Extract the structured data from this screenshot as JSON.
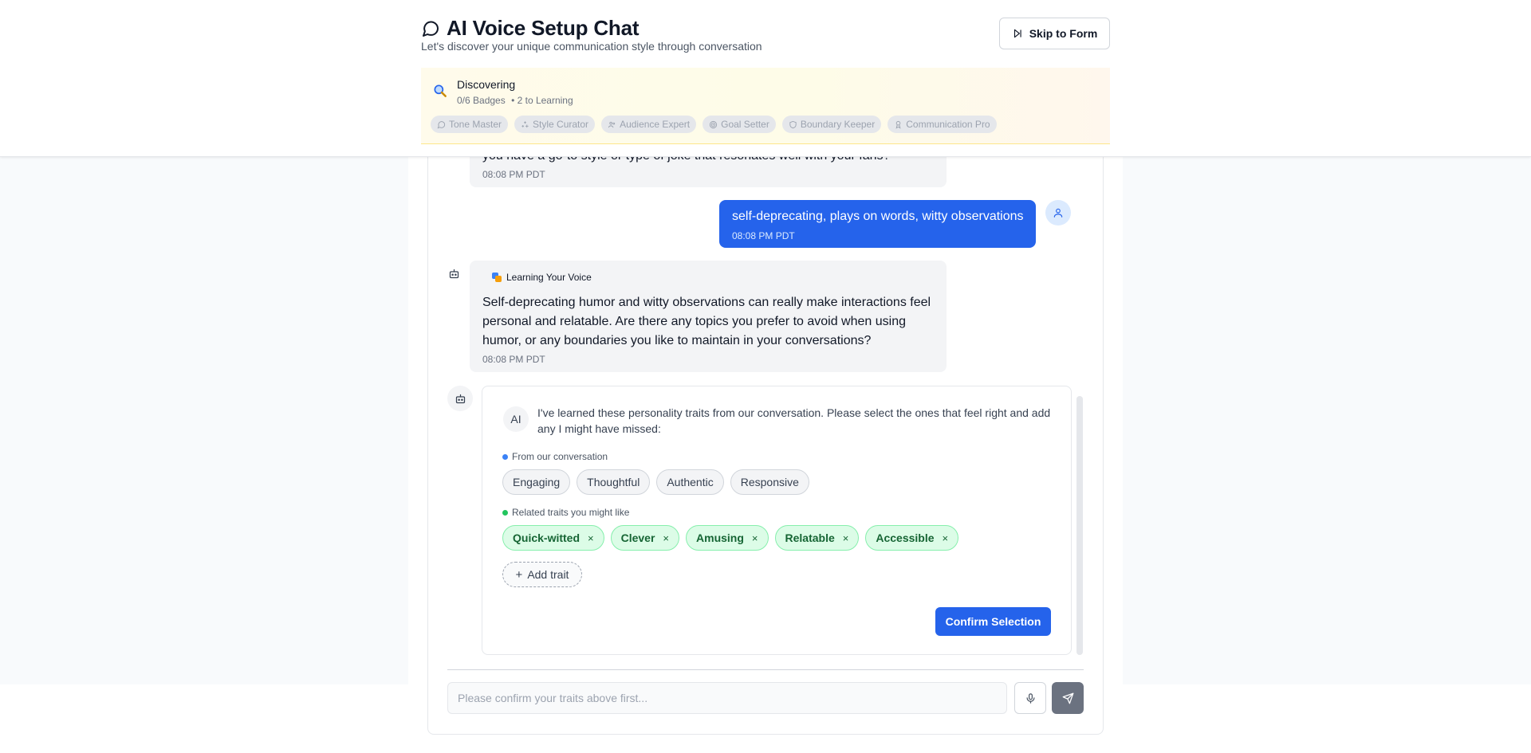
{
  "header": {
    "title": "AI Voice Setup Chat",
    "subtitle": "Let's discover your unique communication style through conversation",
    "skip_label": "Skip to Form"
  },
  "progress": {
    "stage": "Discovering",
    "badges_count": "0/6 Badges",
    "next_stage": "• 2 to Learning",
    "badges": [
      {
        "label": "Tone Master",
        "icon": "message-icon"
      },
      {
        "label": "Style Curator",
        "icon": "sparkles-icon"
      },
      {
        "label": "Audience Expert",
        "icon": "users-icon"
      },
      {
        "label": "Goal Setter",
        "icon": "target-icon"
      },
      {
        "label": "Boundary Keeper",
        "icon": "shield-icon"
      },
      {
        "label": "Communication Pro",
        "icon": "award-icon"
      }
    ]
  },
  "messages": [
    {
      "role": "ai",
      "text": "you have a go-to style or type of joke that resonates well with your fans?",
      "time": "08:08 PM PDT"
    },
    {
      "role": "user",
      "text": "self-deprecating, plays on words, witty observations",
      "time": "08:08 PM PDT"
    },
    {
      "role": "ai",
      "tag": "Learning Your Voice",
      "text": "Self-deprecating humor and witty observations can really make interactions feel personal and relatable. Are there any topics you prefer to avoid when using humor, or any boundaries you like to maintain in your conversations?",
      "time": "08:08 PM PDT"
    }
  ],
  "traits": {
    "ai_label": "AI",
    "intro": "I've learned these personality traits from our conversation. Please select the ones that feel right and add any I might have missed:",
    "conversation_label": "From our conversation",
    "conversation_traits": [
      "Engaging",
      "Thoughtful",
      "Authentic",
      "Responsive"
    ],
    "related_label": "Related traits you might like",
    "related_traits": [
      "Quick-witted",
      "Clever",
      "Amusing",
      "Relatable",
      "Accessible"
    ],
    "remove_glyph": "×",
    "add_label": "Add trait",
    "confirm_label": "Confirm Selection"
  },
  "composer": {
    "placeholder": "Please confirm your traits above first..."
  },
  "colors": {
    "accent": "#2563eb",
    "related_dot": "#22c55e",
    "conversation_dot": "#3b82f6"
  }
}
